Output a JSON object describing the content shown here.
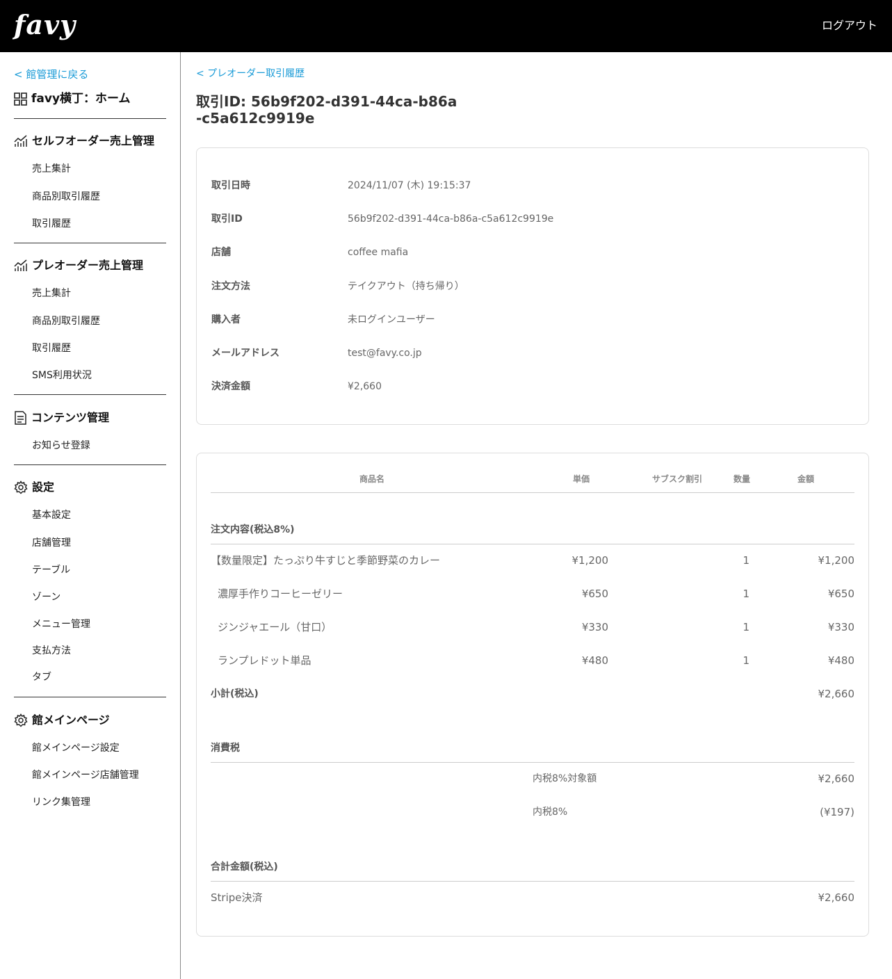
{
  "header": {
    "logo": "favy",
    "logout_label": "ログアウト"
  },
  "sidebar": {
    "back_label": "< 館管理に戻る",
    "home_label": "favy横丁：ホーム",
    "sections": [
      {
        "title": "セルフオーダー売上管理",
        "items": [
          "売上集計",
          "商品別取引履歴",
          "取引履歴"
        ]
      },
      {
        "title": "プレオーダー売上管理",
        "items": [
          "売上集計",
          "商品別取引履歴",
          "取引履歴",
          "SMS利用状況"
        ]
      },
      {
        "title": "コンテンツ管理",
        "items": [
          "お知らせ登録"
        ]
      },
      {
        "title": "設定",
        "items": [
          "基本設定",
          "店舗管理",
          "テーブル",
          "ゾーン",
          "メニュー管理",
          "支払方法",
          "タブ"
        ]
      },
      {
        "title": "館メインページ",
        "items": [
          "館メインページ設定",
          "館メインページ店舗管理",
          "リンク集管理"
        ]
      }
    ]
  },
  "main": {
    "breadcrumb": "< プレオーダー取引履歴",
    "title": "取引ID: 56b9f202-d391-44ca-b86a-c5a612c9919e",
    "info": [
      {
        "label": "取引日時",
        "value": "2024/11/07 (木) 19:15:37"
      },
      {
        "label": "取引ID",
        "value": "56b9f202-d391-44ca-b86a-c5a612c9919e"
      },
      {
        "label": "店舗",
        "value": "coffee mafia"
      },
      {
        "label": "注文方法",
        "value": "テイクアウト（持ち帰り）"
      },
      {
        "label": "購入者",
        "value": "未ログインユーザー"
      },
      {
        "label": "メールアドレス",
        "value": "test@favy.co.jp"
      },
      {
        "label": "決済金額",
        "value": "¥2,660"
      }
    ],
    "order": {
      "columns": {
        "name": "商品名",
        "price": "単価",
        "discount": "サブスク割引",
        "qty": "数量",
        "amount": "金額"
      },
      "group_label": "注文内容(税込8%)",
      "items": [
        {
          "name": "【数量限定】たっぷり牛すじと季節野菜のカレー",
          "price": "¥1,200",
          "qty": "1",
          "amount": "¥1,200"
        },
        {
          "name": "濃厚手作りコーヒーゼリー",
          "price": "¥650",
          "qty": "1",
          "amount": "¥650"
        },
        {
          "name": "ジンジャエール（甘口）",
          "price": "¥330",
          "qty": "1",
          "amount": "¥330"
        },
        {
          "name": "ランプレドット単品",
          "price": "¥480",
          "qty": "1",
          "amount": "¥480"
        }
      ],
      "subtotal_label": "小計(税込)",
      "subtotal_value": "¥2,660",
      "tax": {
        "label": "消費税",
        "rows": [
          {
            "label": "内税8%対象額",
            "value": "¥2,660"
          },
          {
            "label": "内税8%",
            "value": "(¥197)"
          }
        ]
      },
      "total": {
        "label": "合計金額(税込)",
        "method_label": "Stripe決済",
        "method_value": "¥2,660"
      }
    }
  }
}
